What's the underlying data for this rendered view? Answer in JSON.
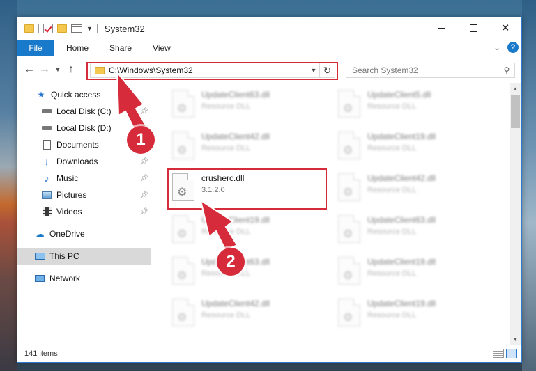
{
  "window": {
    "title": "System32"
  },
  "ribbon": {
    "tabs": [
      "File",
      "Home",
      "Share",
      "View"
    ],
    "help_label": "?"
  },
  "nav": {
    "address": "C:\\Windows\\System32",
    "search_placeholder": "Search System32"
  },
  "sidebar": {
    "items": [
      {
        "label": "Quick access",
        "icon": "star-icon"
      },
      {
        "label": "Local Disk (C:)",
        "icon": "drive-icon",
        "pinned": true
      },
      {
        "label": "Local Disk (D:)",
        "icon": "drive-icon",
        "pinned": true
      },
      {
        "label": "Documents",
        "icon": "documents-icon",
        "pinned": true
      },
      {
        "label": "Downloads",
        "icon": "download-icon",
        "pinned": true
      },
      {
        "label": "Music",
        "icon": "music-icon",
        "pinned": true
      },
      {
        "label": "Pictures",
        "icon": "pictures-icon",
        "pinned": true
      },
      {
        "label": "Videos",
        "icon": "videos-icon",
        "pinned": true
      },
      {
        "label": "OneDrive",
        "icon": "cloud-icon"
      },
      {
        "label": "This PC",
        "icon": "pc-icon",
        "selected": true
      },
      {
        "label": "Network",
        "icon": "network-icon"
      }
    ]
  },
  "files": {
    "left": [
      {
        "name": "UpdateClient63.dll",
        "sub": "Resource DLL"
      },
      {
        "name": "UpdateClient42.dll",
        "sub": "Resource DLL"
      },
      {
        "name": "crusherc.dll",
        "sub": "3.1.2.0"
      },
      {
        "name": "UpdateClient19.dll",
        "sub": "Resource DLL"
      },
      {
        "name": "UpdateClient63.dll",
        "sub": "Resource DLL"
      },
      {
        "name": "UpdateClient42.dll",
        "sub": "Resource DLL"
      }
    ],
    "right": [
      {
        "name": "UpdateClient5.dll",
        "sub": "Resource DLL"
      },
      {
        "name": "UpdateClient19.dll",
        "sub": "Resource DLL"
      },
      {
        "name": "UpdateClient42.dll",
        "sub": "Resource DLL"
      },
      {
        "name": "UpdateClient63.dll",
        "sub": "Resource DLL"
      },
      {
        "name": "UpdateClient19.dll",
        "sub": "Resource DLL"
      },
      {
        "name": "UpdateClient19.dll",
        "sub": "Resource DLL"
      }
    ]
  },
  "status": {
    "item_count": "141 items"
  },
  "callouts": {
    "one": "1",
    "two": "2",
    "highlight_color": "#d62b3a"
  }
}
